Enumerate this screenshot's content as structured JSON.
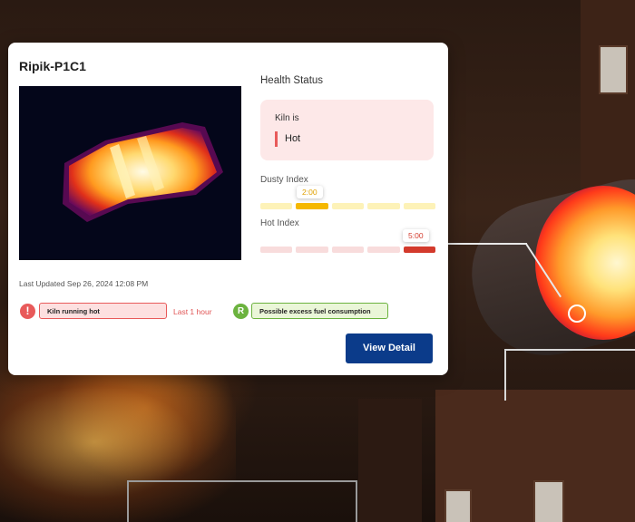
{
  "card": {
    "title": "Ripik-P1C1",
    "last_updated": "Last Updated Sep 26, 2024 12:08 PM"
  },
  "health": {
    "title": "Health Status",
    "status_label": "Kiln is",
    "status_value": "Hot",
    "dusty_index": {
      "label": "Dusty Index",
      "tooltip": "2:00",
      "active_segment": 2,
      "segments": 5
    },
    "hot_index": {
      "label": "Hot Index",
      "tooltip": "5:00",
      "active_segment": 5,
      "segments": 5
    }
  },
  "alerts": [
    {
      "icon": "exclamation-icon",
      "text": "Kiln running hot",
      "time": "Last 1 hour",
      "color": "#e85a5a"
    },
    {
      "icon": "ripik-logo-icon",
      "text": "Possible excess fuel consumption",
      "color": "#6cb33f"
    }
  ],
  "actions": {
    "view_detail": "View Detail"
  },
  "colors": {
    "primary_button": "#0b3b8a",
    "hot": "#d33a2c",
    "dusty": "#f5b800"
  }
}
